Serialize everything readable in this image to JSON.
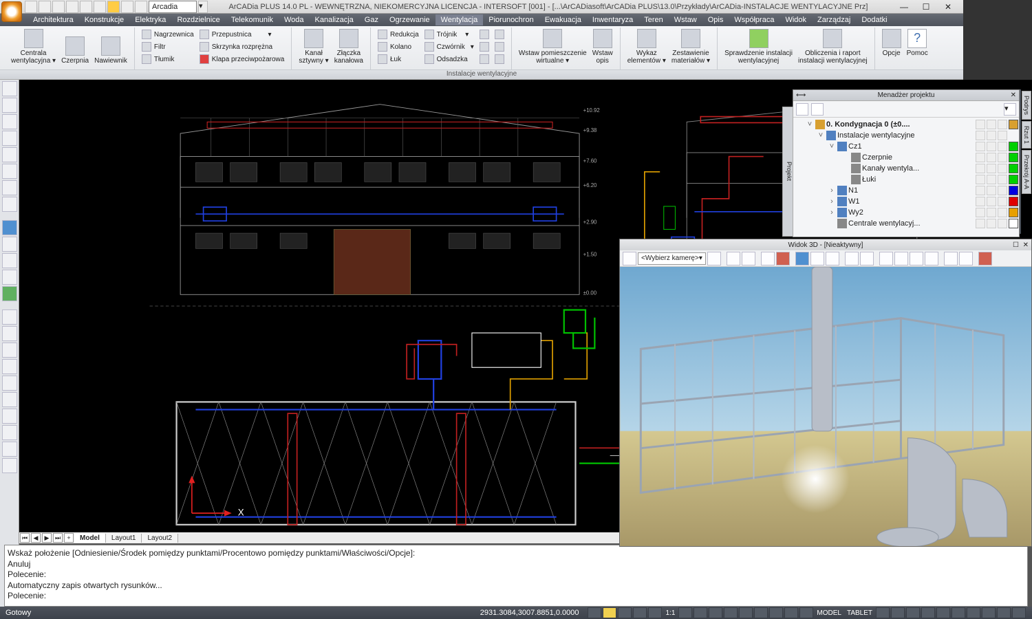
{
  "title": "ArCADia PLUS 14.0 PL - WEWNĘTRZNA, NIEKOMERCYJNA LICENCJA - INTERSOFT [001] - [...\\ArCADiasoft\\ArCADia PLUS\\13.0\\Przykłady\\ArCADia-INSTALACJE WENTYLACYJNE Prz]",
  "qat_combo": "Arcadia",
  "menubar": [
    "Architektura",
    "Konstrukcje",
    "Elektryka",
    "Rozdzielnice",
    "Telekomunik",
    "Woda",
    "Kanalizacja",
    "Gaz",
    "Ogrzewanie",
    "Wentylacja",
    "Piorunochron",
    "Ewakuacja",
    "Inwentaryza",
    "Teren",
    "Wstaw",
    "Opis",
    "Współpraca",
    "Widok",
    "Zarządzaj",
    "Dodatki"
  ],
  "menubar_active": 9,
  "ribbon": {
    "title": "Instalacje wentylacyjne",
    "g1": {
      "b1": "Centrala\nwentylacyjna ▾",
      "b2": "Czerpnia",
      "b3": "Nawiewnik"
    },
    "g2": [
      "Nagrzewnica",
      "Filtr",
      "Tłumik",
      "Przepustnica",
      "Skrzynka rozprężna",
      "Klapa przeciwpożarowa"
    ],
    "g3": {
      "b1": "Kanał\nsztywny ▾",
      "b2": "Złączka\nkanałowa"
    },
    "g4": [
      "Redukcja",
      "Kolano",
      "Łuk",
      "Trójnik",
      "Czwórnik",
      "Odsadzka"
    ],
    "g6": {
      "b1": "Wstaw pomieszczenie\nwirtualne ▾",
      "b2": "Wstaw\nopis"
    },
    "g7": {
      "b1": "Wykaz\nelementów ▾",
      "b2": "Zestawienie\nmateriałów ▾"
    },
    "g8": {
      "b1": "Sprawdzenie instalacji\nwentylacyjnej",
      "b2": "Obliczenia i raport\ninstalacji wentylacyjnej"
    },
    "g9": {
      "b1": "Opcje",
      "b2": "Pomoc"
    }
  },
  "tabs": {
    "t1": "Model",
    "t2": "Layout1",
    "t3": "Layout2"
  },
  "cmd": {
    "l1": "Wskaż położenie [Odniesienie/Środek pomiędzy punktami/Procentowo pomiędzy punktami/Właściwości/Opcje]:",
    "l2": "Anuluj",
    "l3": "Polecenie:",
    "l4": "Automatyczny zapis otwartych rysunków...",
    "l5": "Polecenie:"
  },
  "status": {
    "ready": "Gotowy",
    "coords": "2931.3084,3007.8851,0.0000",
    "model": "MODEL",
    "tablet": "TABLET",
    "r1": "1:1"
  },
  "pm": {
    "title": "Menadżer projektu",
    "rows": [
      {
        "ind": 18,
        "exp": "˅",
        "icn": "#d8a030",
        "lbl": "0. Kondygnacja 0 (±0....",
        "sw": "#d8a030",
        "bold": true
      },
      {
        "ind": 34,
        "exp": "˅",
        "icn": "#5080c0",
        "lbl": "Instalacje wentylacyjne",
        "sw": null
      },
      {
        "ind": 50,
        "exp": "˅",
        "icn": "#5080c0",
        "lbl": "Cz1",
        "sw": "#00d000"
      },
      {
        "ind": 70,
        "exp": "",
        "icn": "#888",
        "lbl": "Czerpnie",
        "sw": "#00d000"
      },
      {
        "ind": 70,
        "exp": "",
        "icn": "#888",
        "lbl": "Kanały wentyla...",
        "sw": "#00d000"
      },
      {
        "ind": 70,
        "exp": "",
        "icn": "#888",
        "lbl": "Łuki",
        "sw": "#00d000"
      },
      {
        "ind": 50,
        "exp": "›",
        "icn": "#5080c0",
        "lbl": "N1",
        "sw": "#0000e0"
      },
      {
        "ind": 50,
        "exp": "›",
        "icn": "#5080c0",
        "lbl": "W1",
        "sw": "#e00000"
      },
      {
        "ind": 50,
        "exp": "›",
        "icn": "#5080c0",
        "lbl": "Wy2",
        "sw": "#e8a000"
      },
      {
        "ind": 50,
        "exp": "",
        "icn": "#888",
        "lbl": "Centrale wentylacyj...",
        "sw": "#ffffff"
      }
    ]
  },
  "sidetabs": [
    "Podrys",
    "Rzut 1",
    "Przekrój A-A"
  ],
  "v3d": {
    "title": "Widok 3D - [Nieaktywny]",
    "cam": "<Wybierz kamerę>"
  }
}
